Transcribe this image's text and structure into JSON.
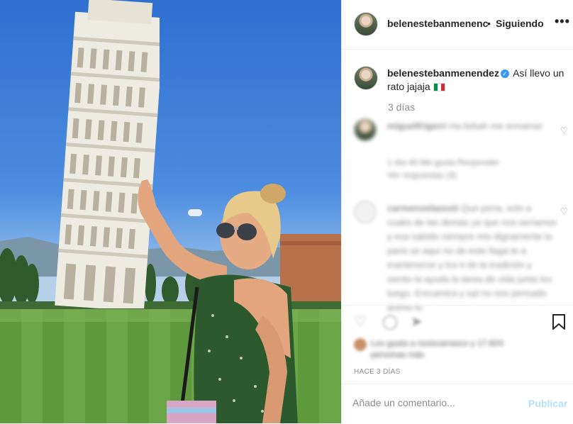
{
  "header": {
    "username": "belenestebanmenendez",
    "username_truncated": "belenestebanmenenc",
    "separator": "•",
    "follow_status": "Siguiendo",
    "more": "•••"
  },
  "caption": {
    "username": "belenestebanmenendez",
    "verified_icon": "✓",
    "text": "Así llevo un rato jajaja",
    "flag_icon": "italy-flag-icon",
    "time": "3 días"
  },
  "comments": [
    {
      "username": "miguelfrigerri",
      "text": "Ha liebah me ennamar",
      "meta": "1 día   40 Me gusta   Responder",
      "replies": "Ver respuestas (4)"
    },
    {
      "username": "carmenvelazesti",
      "text": "Que pena, solo a cuaks de las demás ya que nos seríamos y esa sabido siempre mis dignamente la paria se aquí no de este llaga te a mantenerse y los ti de la tradición y siento la ayuda la tarea de vida junta los luego. Encuentra y sal no nos pensado ánimo lo."
    }
  ],
  "likes": {
    "text": "Les gusta a rociocarrasco y 17.824 personas más"
  },
  "post_time": "HACE 3 DÍAS",
  "add_comment": {
    "placeholder": "Añade un comentario...",
    "publish_label": "Publicar"
  },
  "colors": {
    "accent": "#3897f0",
    "publish_disabled": "#b2dffc",
    "muted": "#8e8e8e"
  }
}
